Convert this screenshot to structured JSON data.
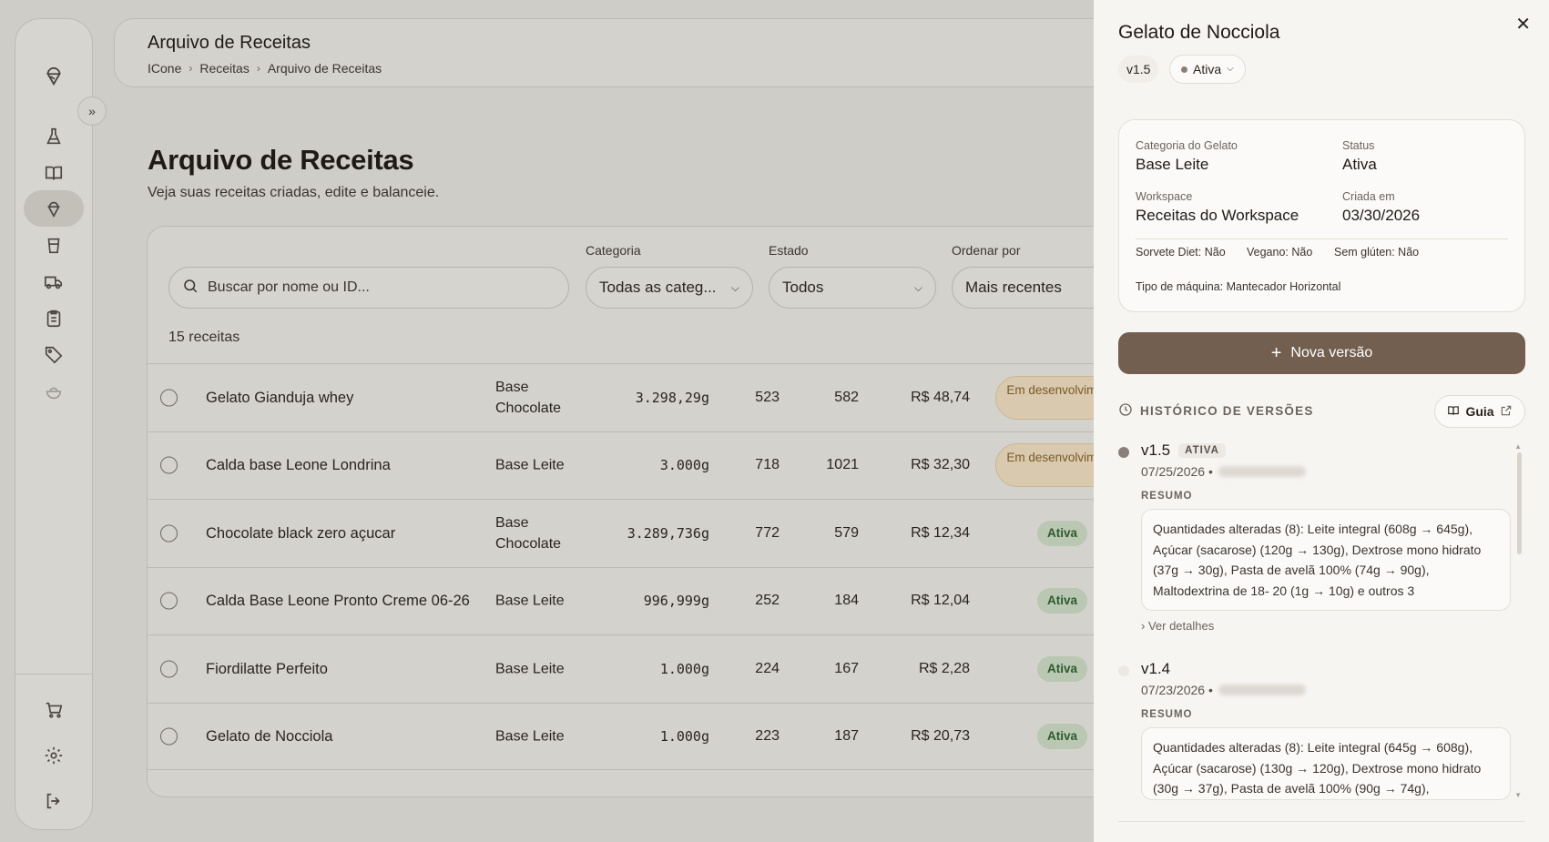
{
  "header": {
    "title": "Arquivo de Receitas",
    "breadcrumb": [
      "ICone",
      "Receitas",
      "Arquivo de Receitas"
    ]
  },
  "page": {
    "title": "Arquivo de Receitas",
    "subtitle": "Veja suas receitas criadas, edite e balanceie."
  },
  "filters": {
    "search_placeholder": "Buscar por nome ou ID...",
    "category_label": "Categoria",
    "category_value": "Todas as categ...",
    "state_label": "Estado",
    "state_value": "Todos",
    "sort_label": "Ordenar por",
    "sort_value": "Mais recentes"
  },
  "count_text": "15 receitas",
  "rows": [
    {
      "name": "Gelato Gianduja whey",
      "category": "Base Chocolate",
      "weight": "3.298,29g",
      "n1": "523",
      "n2": "582",
      "price": "R$ 48,74",
      "status": "Em desenvolvimento",
      "status_type": "dev"
    },
    {
      "name": "Calda base Leone Londrina",
      "category": "Base Leite",
      "weight": "3.000g",
      "n1": "718",
      "n2": "1021",
      "price": "R$ 32,30",
      "status": "Em desenvolvimento",
      "status_type": "dev"
    },
    {
      "name": "Chocolate black zero açucar",
      "category": "Base Chocolate",
      "weight": "3.289,736g",
      "n1": "772",
      "n2": "579",
      "price": "R$ 12,34",
      "status": "Ativa",
      "status_type": "ok"
    },
    {
      "name": "Calda Base Leone Pronto Creme 06-26",
      "category": "Base Leite",
      "weight": "996,999g",
      "n1": "252",
      "n2": "184",
      "price": "R$ 12,04",
      "status": "Ativa",
      "status_type": "ok"
    },
    {
      "name": "Fiordilatte Perfeito",
      "category": "Base Leite",
      "weight": "1.000g",
      "n1": "224",
      "n2": "167",
      "price": "R$ 2,28",
      "status": "Ativa",
      "status_type": "ok"
    },
    {
      "name": "Gelato de Nocciola",
      "category": "Base Leite",
      "weight": "1.000g",
      "n1": "223",
      "n2": "187",
      "price": "R$ 20,73",
      "status": "Ativa",
      "status_type": "ok"
    }
  ],
  "drawer": {
    "title": "Gelato de Nocciola",
    "version": "v1.5",
    "status": "Ativa",
    "info": {
      "category_label": "Categoria do Gelato",
      "category_value": "Base Leite",
      "status_label": "Status",
      "status_value": "Ativa",
      "workspace_label": "Workspace",
      "workspace_value": "Receitas do Workspace",
      "created_label": "Criada em",
      "created_value": "03/30/2026",
      "diet": "Sorvete Diet: Não",
      "vegan": "Vegano: Não",
      "gluten": "Sem glúten: Não",
      "machine": "Tipo de máquina: Mantecador Horizontal"
    },
    "new_version_label": "Nova versão",
    "history_label": "HISTÓRICO DE VERSÕES",
    "guide_label": "Guia",
    "versions": [
      {
        "name": "v1.5",
        "badge": "ATIVA",
        "date": "07/25/2026 •",
        "summary_label": "RESUMO",
        "summary": "Quantidades alteradas (8): Leite integral (608g → 645g), Açúcar (sacarose) (120g → 130g), Dextrose mono hidrato (37g → 30g), Pasta de avelã 100% (74g → 90g), Maltodextrina de 18- 20 (1g → 10g) e outros 3",
        "more": "Ver detalhes"
      },
      {
        "name": "v1.4",
        "badge": "",
        "date": "07/23/2026 •",
        "summary_label": "RESUMO",
        "summary": "Quantidades alteradas (8): Leite integral (645g → 608g), Açúcar (sacarose) (130g → 120g), Dextrose mono hidrato (30g → 37g), Pasta de avelã 100% (90g → 74g),",
        "more": ""
      }
    ]
  },
  "colors": {
    "accent": "#725f4f",
    "active_badge_bg": "#b9c7b3",
    "dev_badge_bg": "#d9c9ae"
  }
}
